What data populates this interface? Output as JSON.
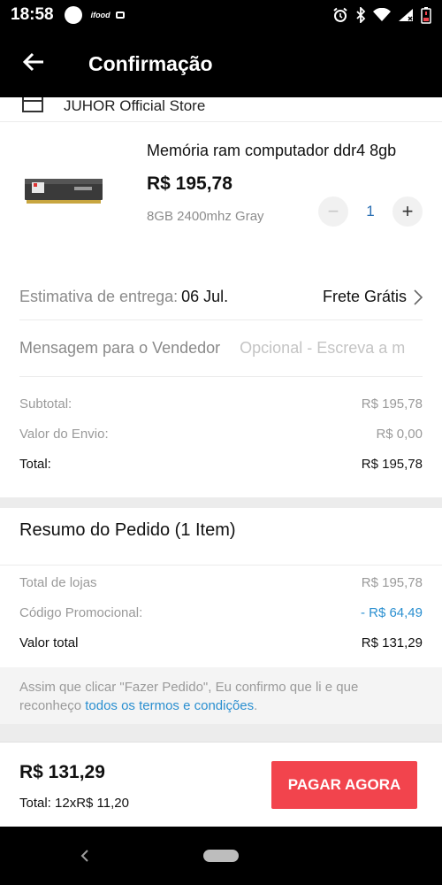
{
  "status_bar": {
    "time": "18:58",
    "app_badge": "ifood",
    "icons": [
      "alarm-icon",
      "bluetooth-icon",
      "wifi-icon",
      "signal-icon",
      "battery-low-icon"
    ]
  },
  "app_bar": {
    "title": "Confirmação",
    "back_icon": "arrow-left-icon"
  },
  "store": {
    "name": "JUHOR Official Store",
    "icon": "store-icon"
  },
  "product": {
    "title": "Memória ram computador ddr4 8gb",
    "price": "R$ 195,78",
    "variant": "8GB 2400mhz Gray",
    "quantity": "1",
    "minus_label": "−",
    "plus_label": "+"
  },
  "delivery": {
    "label": "Estimativa de entrega:",
    "date": "06 Jul.",
    "shipping": "Frete Grátis"
  },
  "message": {
    "label": "Mensagem para o Vendedor",
    "placeholder": "Opcional - Escreva a m",
    "value": ""
  },
  "store_summary": {
    "subtotal_label": "Subtotal:",
    "subtotal_value": "R$ 195,78",
    "shipping_label": "Valor do Envio:",
    "shipping_value": "R$ 0,00",
    "total_label": "Total:",
    "total_value": "R$ 195,78"
  },
  "order_summary": {
    "title": "Resumo do Pedido (1 Item)",
    "stores_total_label": "Total de lojas",
    "stores_total_value": "R$ 195,78",
    "promo_label": "Código Promocional:",
    "promo_value": "- R$ 64,49",
    "grand_total_label": "Valor total",
    "grand_total_value": "R$ 131,29"
  },
  "terms": {
    "text": "Assim que clicar \"Fazer Pedido\", Eu confirmo que li e que reconheço ",
    "link": "todos os termos e condições",
    "suffix": "."
  },
  "pay_bar": {
    "total": "R$ 131,29",
    "installments": "Total: 12xR$ 11,20",
    "button_label": "PAGAR AGORA"
  },
  "colors": {
    "accent_red": "#f2444d",
    "link_blue": "#2a8fd0",
    "bar_black": "#000000"
  }
}
